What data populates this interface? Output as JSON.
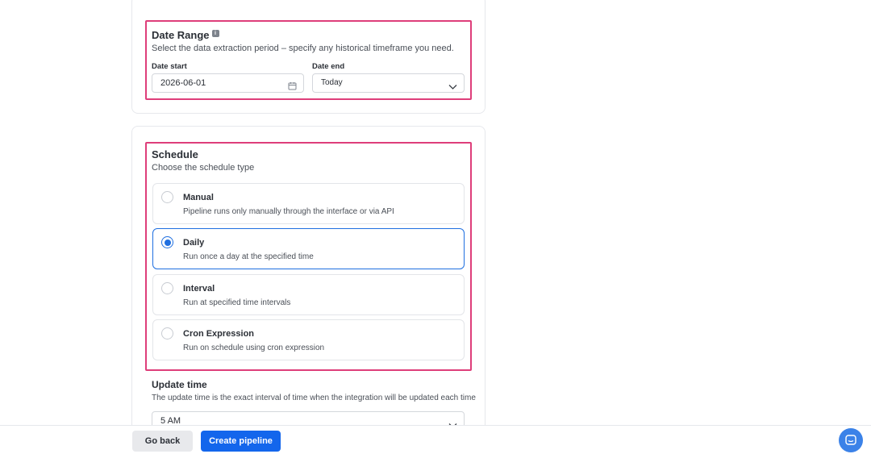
{
  "date_range": {
    "title": "Date Range",
    "description": "Select the data extraction period – specify any historical timeframe you need.",
    "start_label": "Date start",
    "start_value": "2026-06-01",
    "end_label": "Date end",
    "end_value": "Today"
  },
  "schedule": {
    "title": "Schedule",
    "description": "Choose the schedule type",
    "options": [
      {
        "title": "Manual",
        "description": "Pipeline runs only manually through the interface or via API",
        "selected": false
      },
      {
        "title": "Daily",
        "description": "Run once a day at the specified time",
        "selected": true
      },
      {
        "title": "Interval",
        "description": "Run at specified time intervals",
        "selected": false
      },
      {
        "title": "Cron Expression",
        "description": "Run on schedule using cron expression",
        "selected": false
      }
    ]
  },
  "update_time": {
    "title": "Update time",
    "description": "The update time is the exact interval of time when the integration will be updated each time",
    "value": "5 AM"
  },
  "footer": {
    "back_label": "Go back",
    "create_label": "Create pipeline"
  },
  "colors": {
    "accent": "#1366ec",
    "highlight": "#de3e7a"
  },
  "icons": {
    "info": "info-icon",
    "calendar": "calendar-icon",
    "dropdown": "chevron-down-icon",
    "chat": "chat-icon"
  }
}
